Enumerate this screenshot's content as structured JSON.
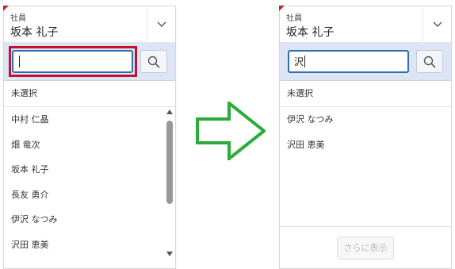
{
  "left_panel": {
    "field_label": "社員",
    "selected_value": "坂本 礼子",
    "search_value": "",
    "unselected_label": "未選択",
    "items": [
      {
        "label": "中村 仁晶"
      },
      {
        "label": "畑 竜次"
      },
      {
        "label": "坂本 礼子"
      },
      {
        "label": "長友 勇介"
      },
      {
        "label": "伊沢 なつみ"
      },
      {
        "label": "沢田 恵美"
      }
    ]
  },
  "right_panel": {
    "field_label": "社員",
    "selected_value": "坂本 礼子",
    "search_value": "沢",
    "unselected_label": "未選択",
    "items": [
      {
        "label": "伊沢 なつみ"
      },
      {
        "label": "沢田 恵美"
      }
    ],
    "more_button_label": "さらに表示"
  },
  "colors": {
    "highlight": "#c8102e",
    "arrow": "#2bab38",
    "search_bar_bg": "#dbe5f3",
    "input_border": "#2f6dae"
  },
  "icons": {
    "dropdown": "chevron-down-icon",
    "search": "search-icon",
    "flow": "right-arrow-icon"
  }
}
